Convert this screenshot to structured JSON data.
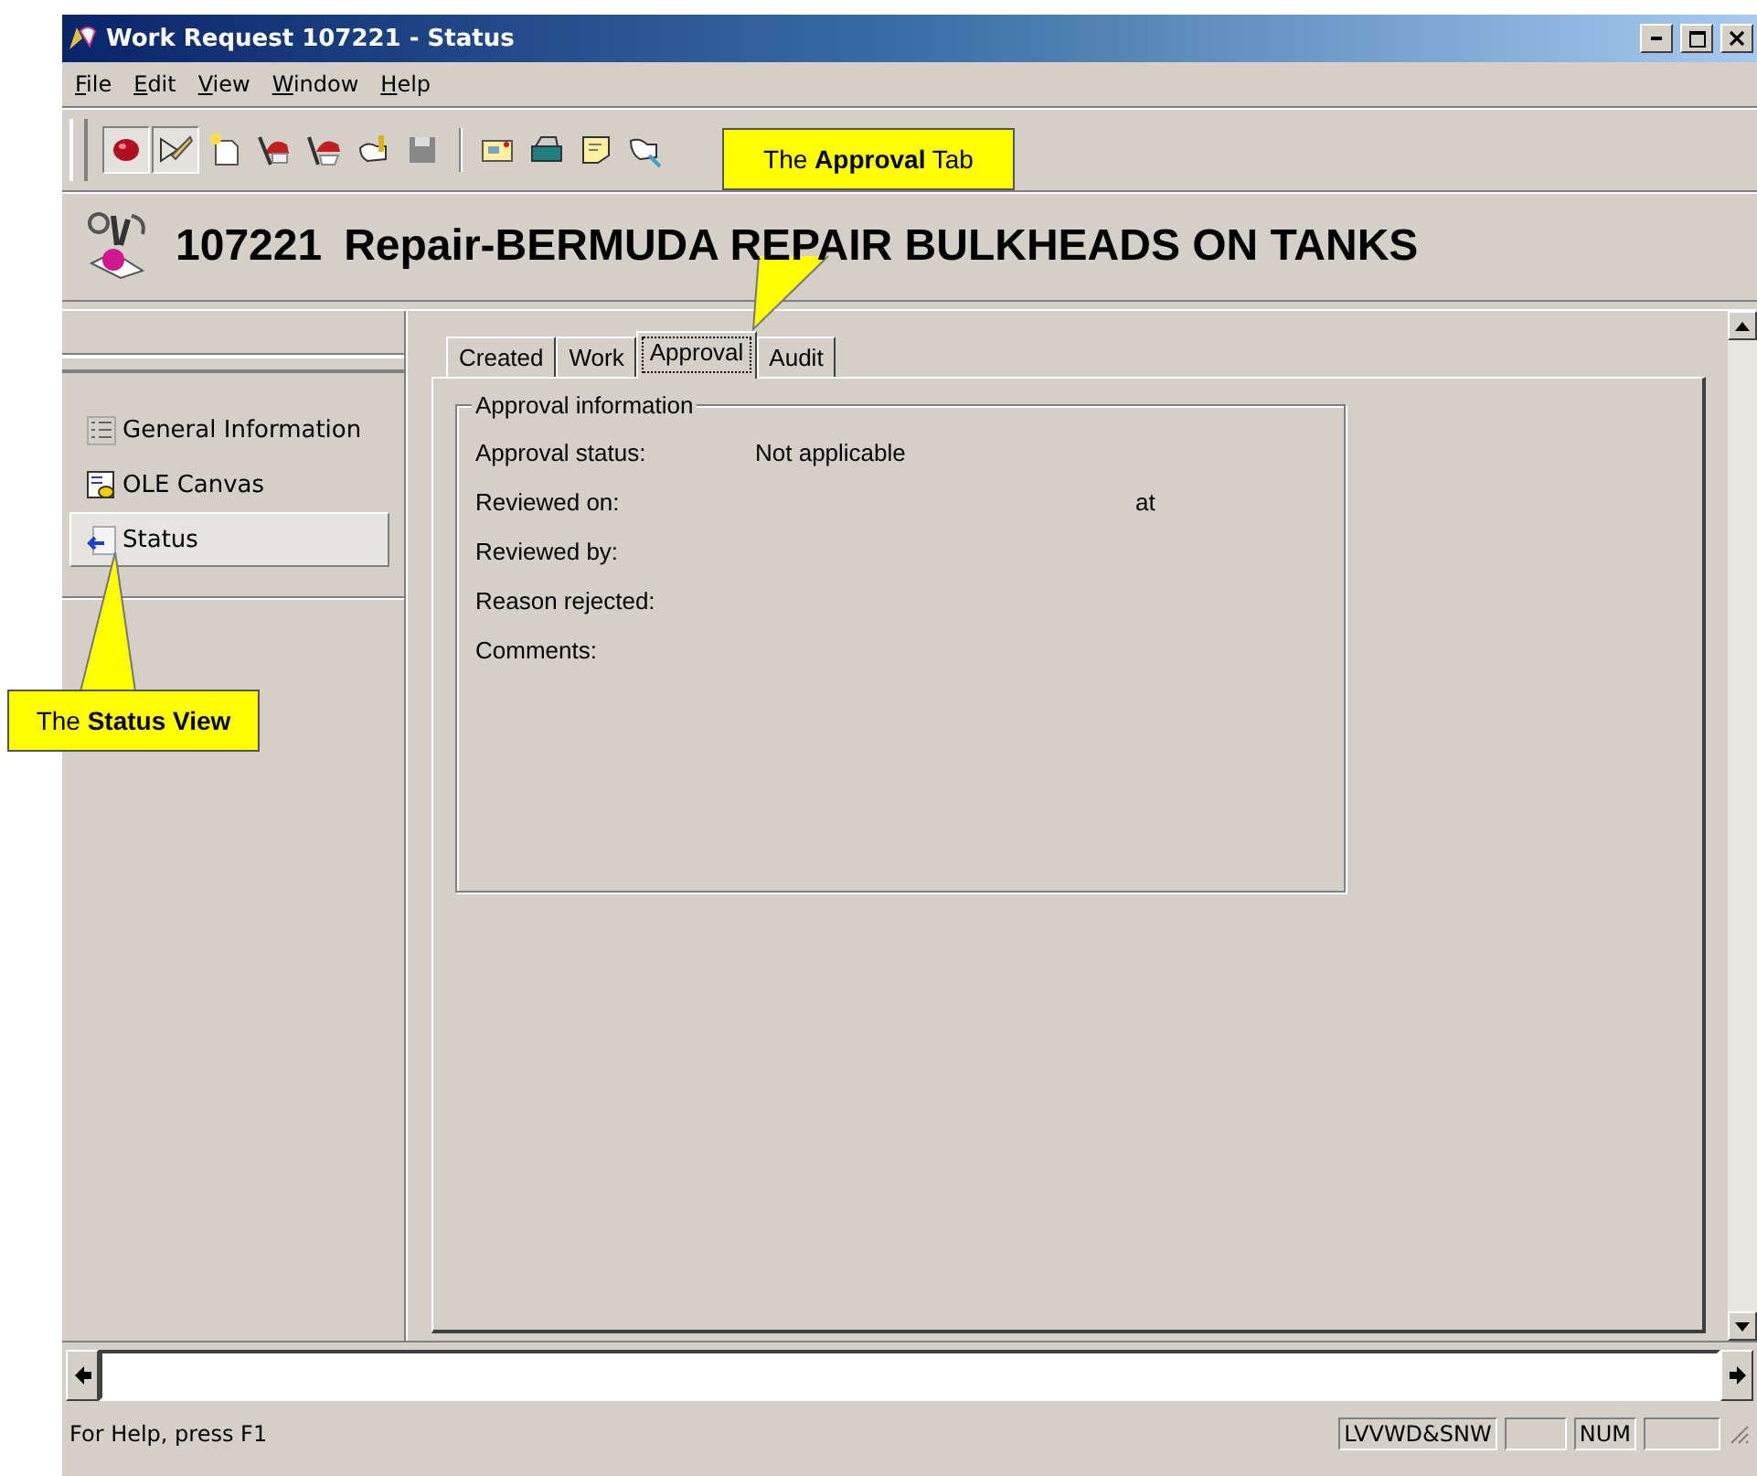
{
  "window": {
    "title": "Work Request 107221 - Status"
  },
  "menu": [
    "File",
    "Edit",
    "View",
    "Window",
    "Help"
  ],
  "toolbar": [
    {
      "pressed": true
    },
    {
      "pressed": true
    },
    {
      "pressed": false
    },
    {
      "pressed": false
    },
    {
      "pressed": false
    },
    {
      "pressed": false
    },
    {
      "pressed": false
    },
    {
      "pressed": false
    },
    {
      "pressed": false
    },
    {
      "pressed": false
    },
    {
      "pressed": false
    }
  ],
  "header": {
    "number": "107221",
    "title": "Repair-BERMUDA REPAIR BULKHEADS ON TANKS"
  },
  "sidebar": {
    "items": [
      {
        "label": "General Information",
        "selected": false
      },
      {
        "label": "OLE Canvas",
        "selected": false
      },
      {
        "label": "Status",
        "selected": true
      }
    ]
  },
  "tabs": [
    {
      "label": "Created",
      "selected": false
    },
    {
      "label": "Work",
      "selected": false
    },
    {
      "label": "Approval",
      "selected": true
    },
    {
      "label": "Audit",
      "selected": false
    }
  ],
  "approval": {
    "group_title": "Approval information",
    "fields": [
      {
        "label": "Approval status:",
        "value": "Not applicable"
      },
      {
        "label": "Reviewed on:",
        "time_label": "at"
      },
      {
        "label": "Reviewed by:"
      },
      {
        "label": "Reason rejected:"
      },
      {
        "label": "Comments:"
      }
    ]
  },
  "status_bar": {
    "message": "For Help, press F1",
    "panes": [
      "LVVWD&SNW",
      "NUM"
    ]
  },
  "callouts": [
    {
      "text": "The **Approval** Tab"
    },
    {
      "text": "The **Status View**"
    }
  ]
}
